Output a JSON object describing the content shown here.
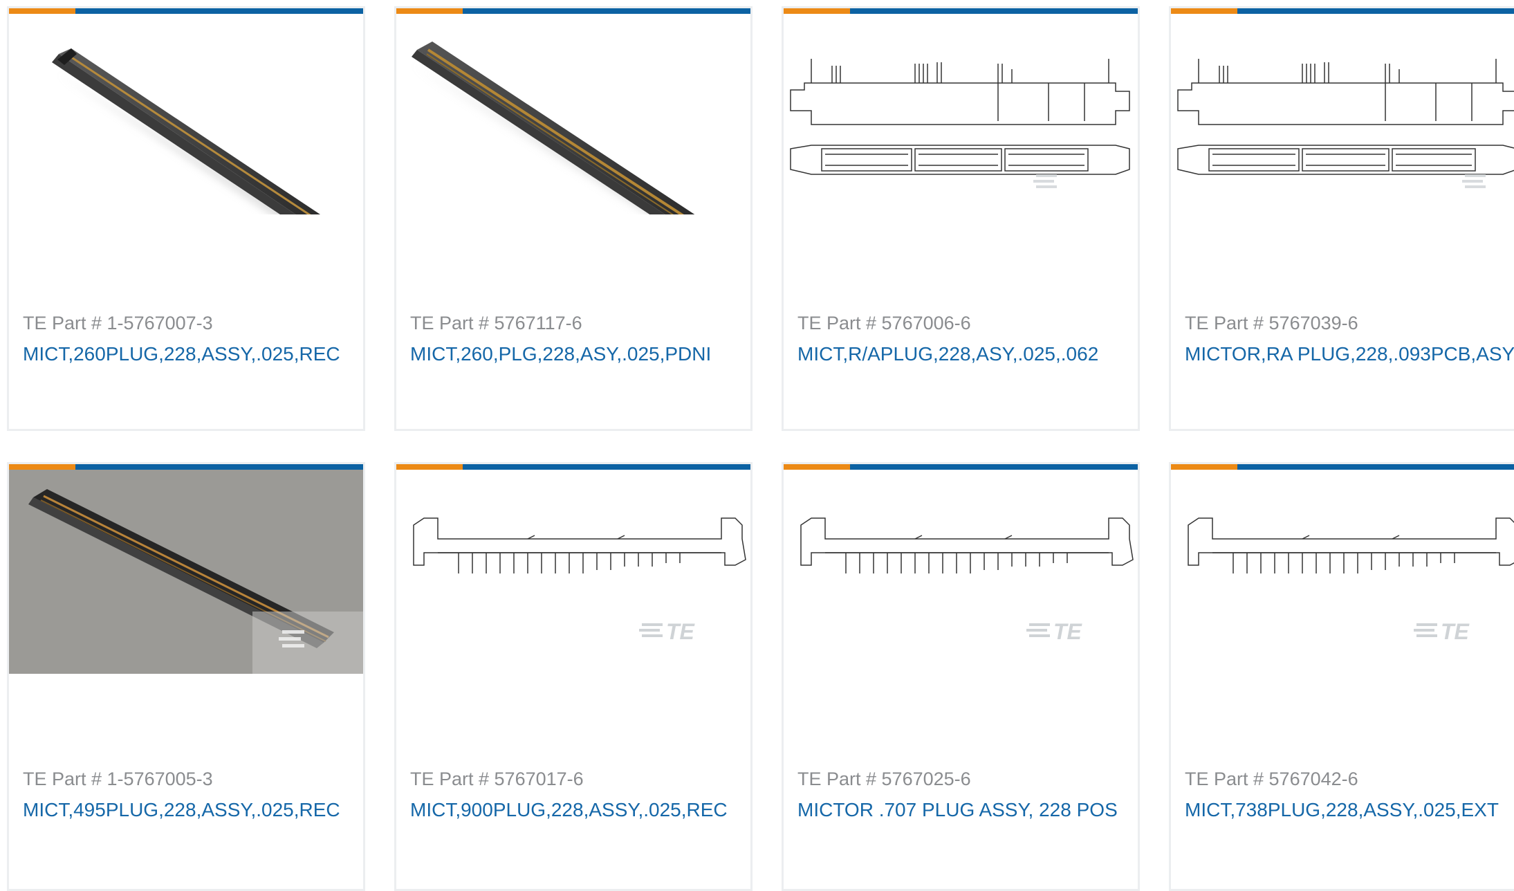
{
  "colors": {
    "accent_orange": "#ec8a16",
    "accent_blue": "#0c62a3",
    "part_number_text": "#8a8c8f",
    "link_text": "#1567a8",
    "card_border": "#eceef0"
  },
  "products": [
    {
      "part_number": "TE Part # 1-5767007-3",
      "description": "MICT,260PLUG,228,ASSY,.025,REC",
      "image": "connector-3d-render-icon"
    },
    {
      "part_number": "TE Part # 5767117-6",
      "description": "MICT,260,PLG,228,ASY,.025,PDNI",
      "image": "connector-3d-render-icon"
    },
    {
      "part_number": "TE Part # 5767006-6",
      "description": "MICT,R/APLUG,228,ASY,.025,.062",
      "image": "connector-line-drawing-icon"
    },
    {
      "part_number": "TE Part # 5767039-6",
      "description": "MICTOR,RA PLUG,228,.093PCB,ASY",
      "image": "connector-line-drawing-icon"
    },
    {
      "part_number": "TE Part # 1-5767005-3",
      "description": "MICT,495PLUG,228,ASSY,.025,REC",
      "image": "connector-photo-icon"
    },
    {
      "part_number": "TE Part # 5767017-6",
      "description": "MICT,900PLUG,228,ASSY,.025,REC",
      "image": "connector-side-drawing-icon"
    },
    {
      "part_number": "TE Part # 5767025-6",
      "description": "MICTOR .707 PLUG ASSY, 228 POS",
      "image": "connector-side-drawing-icon"
    },
    {
      "part_number": "TE Part # 5767042-6",
      "description": "MICT,738PLUG,228,ASSY,.025,EXT",
      "image": "connector-side-drawing-icon"
    }
  ],
  "watermark": {
    "text": "TE"
  }
}
